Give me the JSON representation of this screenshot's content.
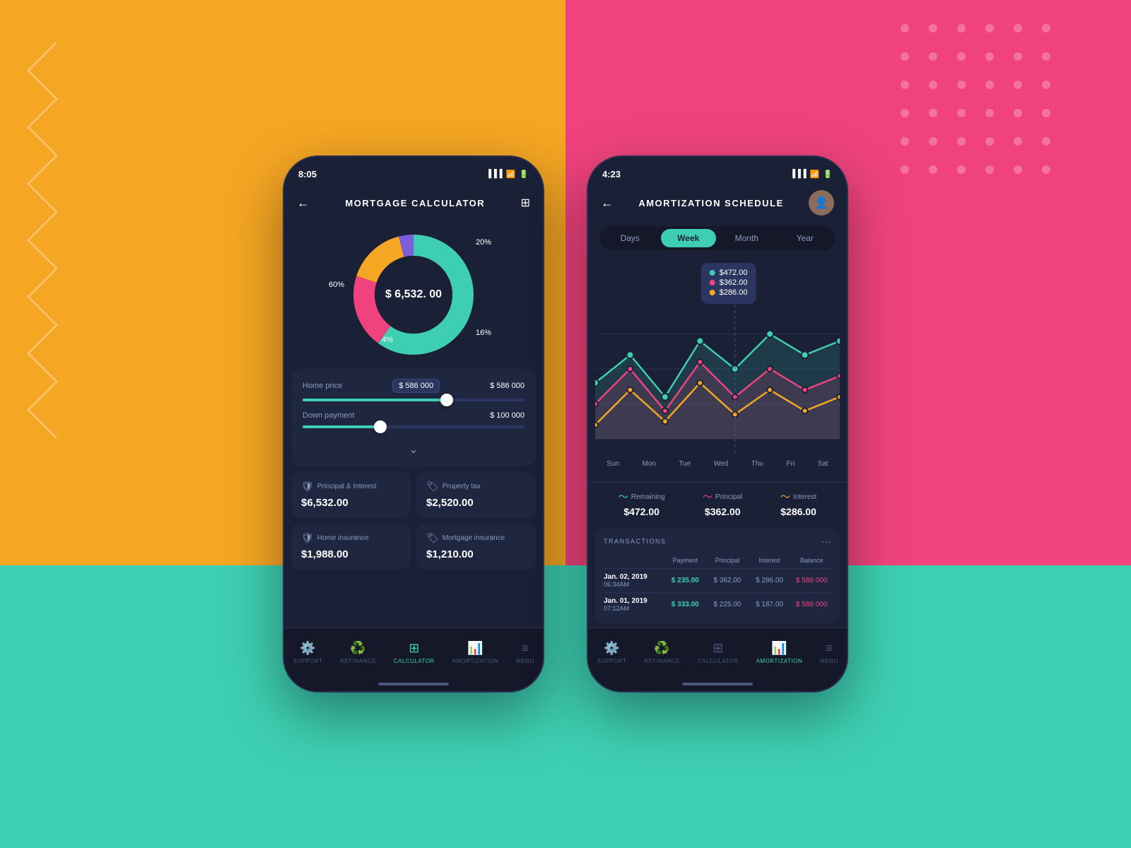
{
  "backgrounds": {
    "left_color": "#F5A623",
    "right_color": "#F0437E",
    "bottom_color": "#3ECFB2"
  },
  "phone1": {
    "status_time": "8:05",
    "title": "MORTGAGE CALCULATOR",
    "donut_center_amount": "$ 6,532. 00",
    "donut_labels": {
      "pct20": "20%",
      "pct60": "60%",
      "pct16": "16%",
      "pct4": "4%"
    },
    "home_price_label": "Home price",
    "home_price_badge": "$ 586 000",
    "home_price_value": "$ 586 000",
    "down_payment_label": "Down payment",
    "down_payment_value": "$ 100 000",
    "stats": [
      {
        "icon": "🛡",
        "label": "Principal & Interest",
        "value": "$6,532.00"
      },
      {
        "icon": "🏷",
        "label": "Property tax",
        "value": "$2,520.00"
      },
      {
        "icon": "🛡",
        "label": "Home insurance",
        "value": "$1,988.00"
      },
      {
        "icon": "🏷",
        "label": "Mortgage insurance",
        "value": "$1,210.00"
      }
    ],
    "bottom_nav": [
      {
        "label": "SUPPORT",
        "icon": "⚙",
        "active": false
      },
      {
        "label": "REFINANCE",
        "icon": "♻",
        "active": false
      },
      {
        "label": "CALCULATOR",
        "icon": "⊞",
        "active": true
      },
      {
        "label": "AMORTIZATION",
        "icon": "📊",
        "active": false
      },
      {
        "label": "MENU",
        "icon": "≡",
        "active": false
      }
    ]
  },
  "phone2": {
    "status_time": "4:23",
    "title": "AMORTIZATION SCHEDULE",
    "period_tabs": [
      "Days",
      "Week",
      "Month",
      "Year"
    ],
    "active_tab": "Week",
    "chart_tooltip": {
      "values": [
        "$472.00",
        "$362.00",
        "$286.00"
      ],
      "colors": [
        "#3ECFB2",
        "#F0437E",
        "#F5A623"
      ]
    },
    "x_labels": [
      "Sun",
      "Mon",
      "Tue",
      "Wed",
      "Thu",
      "Fri",
      "Sat"
    ],
    "metrics": [
      {
        "label": "Remaining",
        "value": "$472.00",
        "color": "teal"
      },
      {
        "label": "Principal",
        "value": "$362.00",
        "color": "pink"
      },
      {
        "label": "Interest",
        "value": "$286.00",
        "color": "yellow"
      }
    ],
    "transactions_title": "TRANSACTIONS",
    "transactions_col_headers": [
      "",
      "Payment",
      "Principal",
      "Interest",
      "Balance"
    ],
    "transactions": [
      {
        "date": "Jan. 02, 2019",
        "time": "06:34AM",
        "payment": "$ 235.00",
        "principal": "$ 362.00",
        "interest": "$ 286.00",
        "balance": "$ 586 000"
      },
      {
        "date": "Jan. 01, 2019",
        "time": "07:12AM",
        "payment": "$ 333.00",
        "principal": "$ 225.00",
        "interest": "$ 187.00",
        "balance": "$ 586 000"
      }
    ],
    "bottom_nav": [
      {
        "label": "SUPPORT",
        "icon": "⚙",
        "active": false
      },
      {
        "label": "REFINANCE",
        "icon": "♻",
        "active": false
      },
      {
        "label": "CALCULATOR",
        "icon": "⊞",
        "active": false
      },
      {
        "label": "AMORTIZATION",
        "icon": "📊",
        "active": true
      },
      {
        "label": "MENU",
        "icon": "≡",
        "active": false
      }
    ]
  }
}
